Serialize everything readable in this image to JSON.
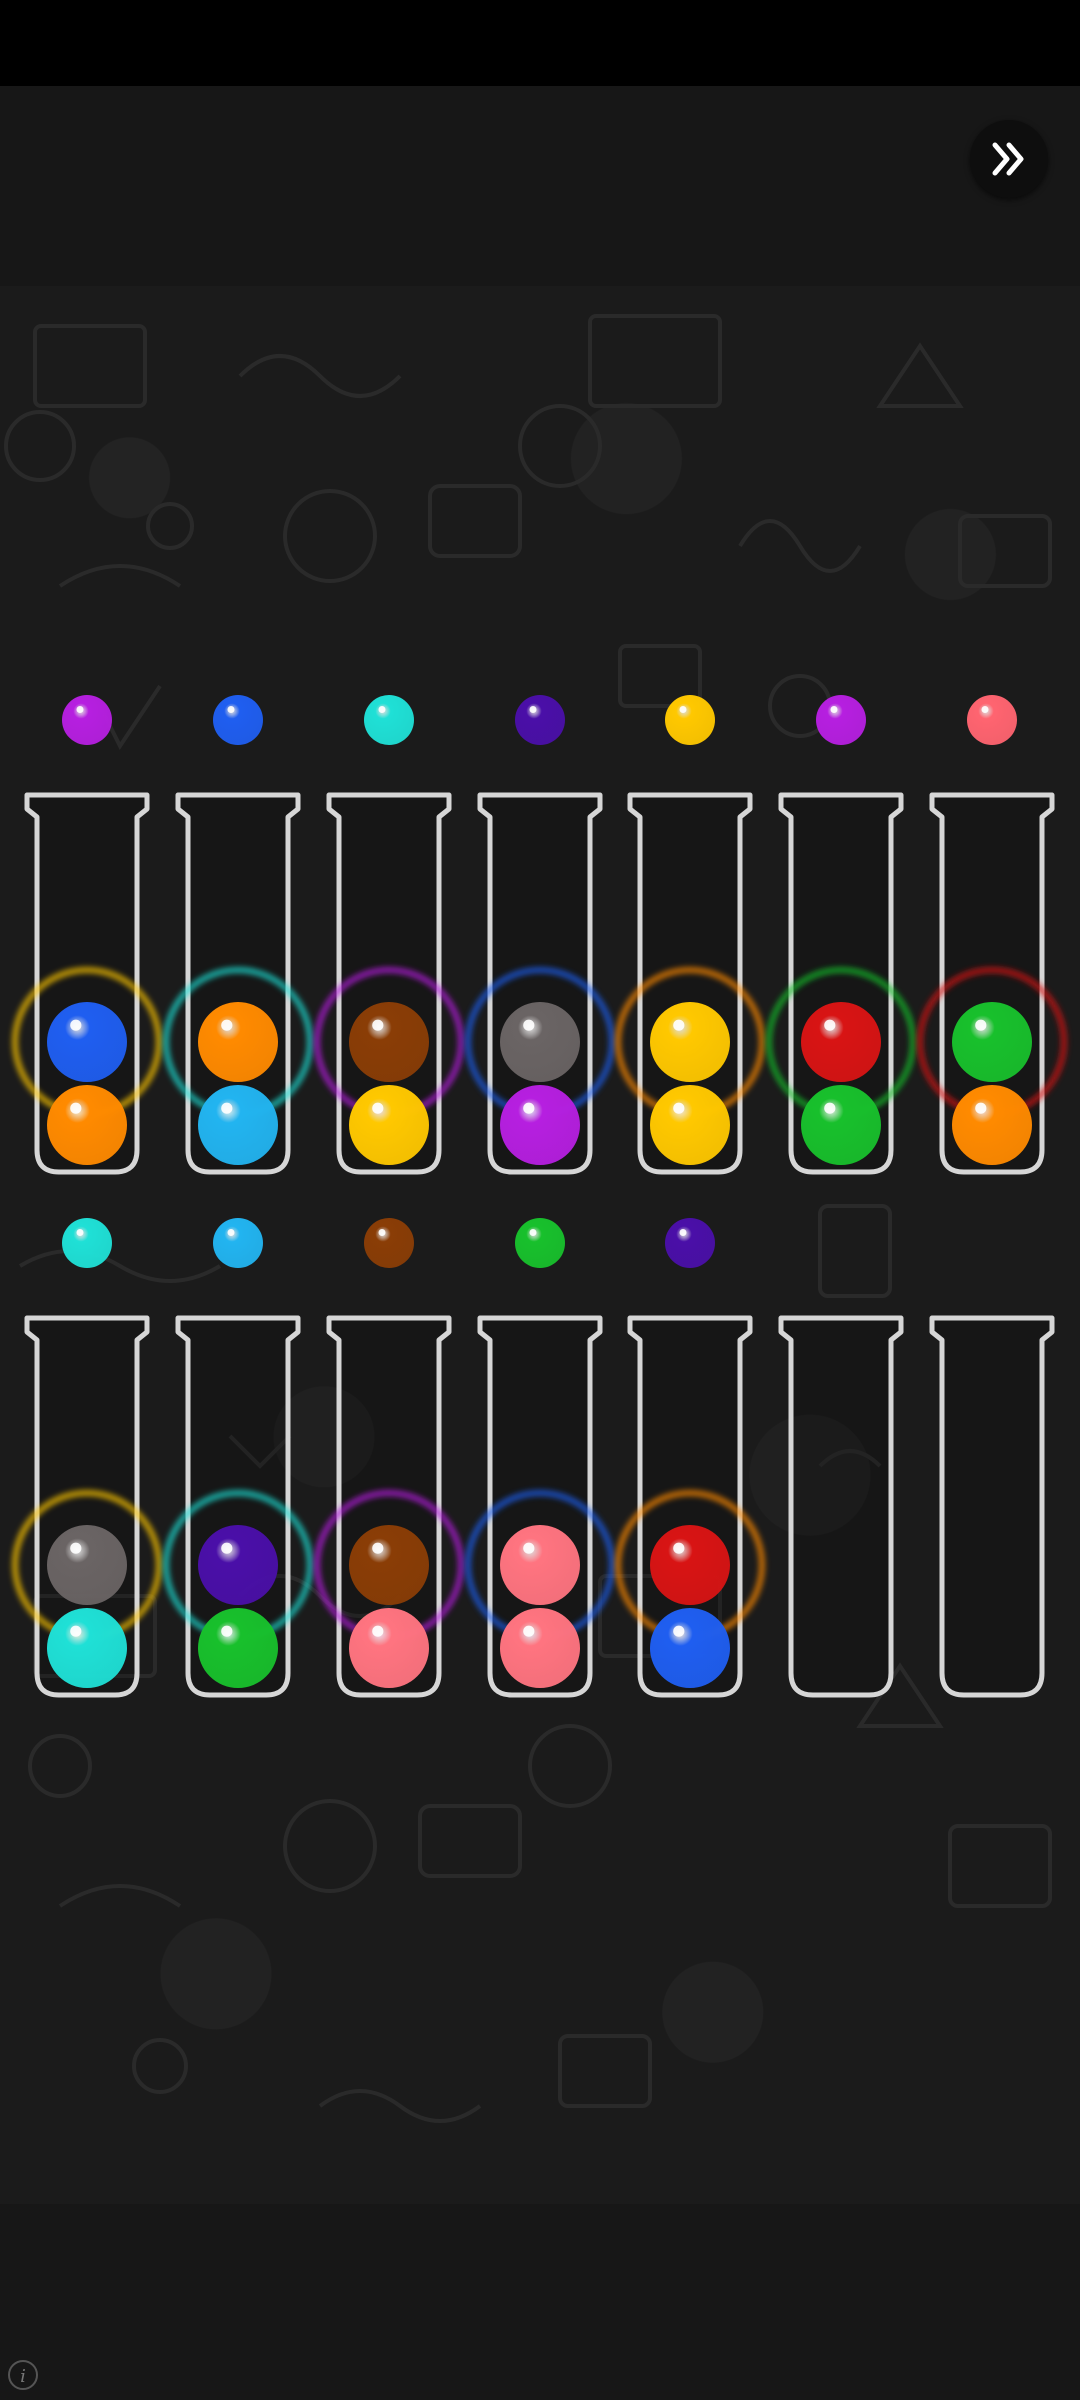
{
  "colors": {
    "purple": "#b61fe0",
    "blue": "#1f5ef0",
    "cyan": "#1fe0d6",
    "dark_purple": "#4a0fa8",
    "yellow": "#ffc800",
    "pink": "#ff6470",
    "orange": "#ff8a00",
    "brown": "#8a3d06",
    "gray": "#6a6464",
    "red": "#d81414",
    "green": "#18c02c",
    "sky": "#22b4f0",
    "rose": "#ff7480"
  },
  "icons": {
    "skip": "double-chevron-right-icon",
    "info": "info-icon"
  },
  "info_label": "i",
  "tubes": [
    {
      "row": 0,
      "indicator": "purple",
      "glow": "yellow",
      "balls": [
        "blue",
        "orange"
      ]
    },
    {
      "row": 0,
      "indicator": "blue",
      "glow": "cyan",
      "balls": [
        "orange",
        "sky"
      ]
    },
    {
      "row": 0,
      "indicator": "cyan",
      "glow": "purple",
      "balls": [
        "brown",
        "yellow"
      ]
    },
    {
      "row": 0,
      "indicator": "dark_purple",
      "glow": "blue",
      "balls": [
        "gray",
        "purple"
      ]
    },
    {
      "row": 0,
      "indicator": "yellow",
      "glow": "orange",
      "balls": [
        "yellow",
        "yellow"
      ]
    },
    {
      "row": 0,
      "indicator": "purple",
      "glow": "green",
      "balls": [
        "red",
        "green"
      ]
    },
    {
      "row": 0,
      "indicator": "pink",
      "glow": "red",
      "balls": [
        "green",
        "orange"
      ]
    },
    {
      "row": 1,
      "indicator": "cyan",
      "glow": "yellow",
      "balls": [
        "gray",
        "cyan"
      ]
    },
    {
      "row": 1,
      "indicator": "sky",
      "glow": "cyan",
      "balls": [
        "dark_purple",
        "green"
      ]
    },
    {
      "row": 1,
      "indicator": "brown",
      "glow": "purple",
      "balls": [
        "brown",
        "rose"
      ]
    },
    {
      "row": 1,
      "indicator": "green",
      "glow": "blue",
      "balls": [
        "rose",
        "rose"
      ]
    },
    {
      "row": 1,
      "indicator": "dark_purple",
      "glow": "orange",
      "balls": [
        "red",
        "blue"
      ]
    },
    {
      "row": 1,
      "indicator": null,
      "glow": null,
      "balls": []
    },
    {
      "row": 1,
      "indicator": null,
      "glow": null,
      "balls": []
    }
  ]
}
